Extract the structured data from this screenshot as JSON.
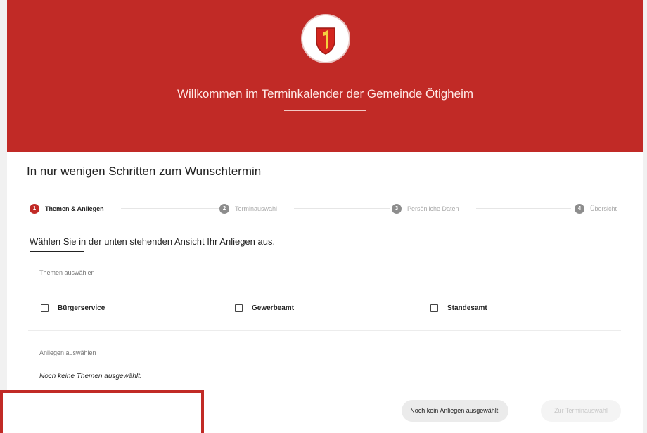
{
  "header": {
    "title": "Willkommen im Terminkalender der Gemeinde Ötigheim",
    "logo_name": "Ötigheim coat of arms",
    "accent_color": "#c12a26"
  },
  "main": {
    "title": "In nur wenigen Schritten zum Wunschtermin",
    "steps": [
      {
        "number": "1",
        "label": "Themen & Anliegen",
        "active": true
      },
      {
        "number": "2",
        "label": "Terminauswahl",
        "active": false
      },
      {
        "number": "3",
        "label": "Persönliche Daten",
        "active": false
      },
      {
        "number": "4",
        "label": "Übersicht",
        "active": false
      }
    ],
    "section_heading": "Wählen Sie in der unten stehenden Ansicht Ihr Anliegen aus.",
    "topics_label": "Themen auswählen",
    "topics": [
      {
        "label": "Bürgerservice",
        "checked": false
      },
      {
        "label": "Gewerbeamt",
        "checked": false
      },
      {
        "label": "Standesamt",
        "checked": false
      }
    ],
    "concerns_label": "Anliegen auswählen",
    "no_topics_text": "Noch keine Themen ausgewählt."
  },
  "footer": {
    "no_concern_button": "Noch kein Anliegen ausgewählt.",
    "next_button": "Zur Terminauswahl"
  }
}
